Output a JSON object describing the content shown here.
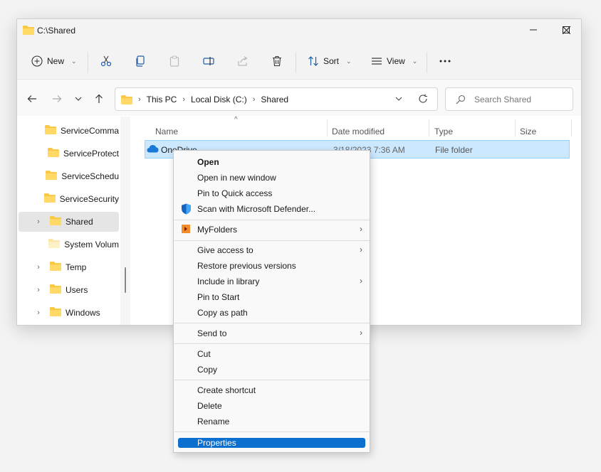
{
  "window": {
    "title": "C:\\Shared"
  },
  "toolbar": {
    "new_label": "New",
    "sort_label": "Sort",
    "view_label": "View",
    "icons": [
      "plus-circle-icon",
      "cut-icon",
      "copy-icon",
      "paste-icon",
      "rename-icon",
      "share-icon",
      "delete-icon",
      "sort-icon",
      "view-icon",
      "more-icon"
    ]
  },
  "address": {
    "crumbs": [
      "This PC",
      "Local Disk (C:)",
      "Shared"
    ],
    "search_placeholder": "Search Shared"
  },
  "navpane": {
    "items": [
      {
        "label": "ServiceComma",
        "expandable": false
      },
      {
        "label": "ServiceProtect",
        "expandable": false
      },
      {
        "label": "ServiceSchedu",
        "expandable": false
      },
      {
        "label": "ServiceSecurity",
        "expandable": false
      },
      {
        "label": "Shared",
        "expandable": true,
        "selected": true
      },
      {
        "label": "System Volum",
        "expandable": false
      },
      {
        "label": "Temp",
        "expandable": true
      },
      {
        "label": "Users",
        "expandable": true
      },
      {
        "label": "Windows",
        "expandable": true
      }
    ]
  },
  "list": {
    "columns": [
      "Name",
      "Date modified",
      "Type",
      "Size"
    ],
    "rows": [
      {
        "name": "OneDrive",
        "date": "3/18/2023 7:36 AM",
        "type": "File folder",
        "size": ""
      }
    ]
  },
  "context_menu": {
    "group1": [
      "Open",
      "Open in new window",
      "Pin to Quick access",
      "Scan with Microsoft Defender..."
    ],
    "group2": [
      "MyFolders"
    ],
    "group3": [
      "Give access to",
      "Restore previous versions",
      "Include in library",
      "Pin to Start",
      "Copy as path"
    ],
    "group4": [
      "Send to"
    ],
    "group5": [
      "Cut",
      "Copy"
    ],
    "group6": [
      "Create shortcut",
      "Delete",
      "Rename"
    ],
    "group7": [
      "Properties"
    ]
  },
  "colors": {
    "accent": "#0a6fcf",
    "selection_bg": "#cce8ff",
    "folder_yellow": "#f8c846"
  }
}
